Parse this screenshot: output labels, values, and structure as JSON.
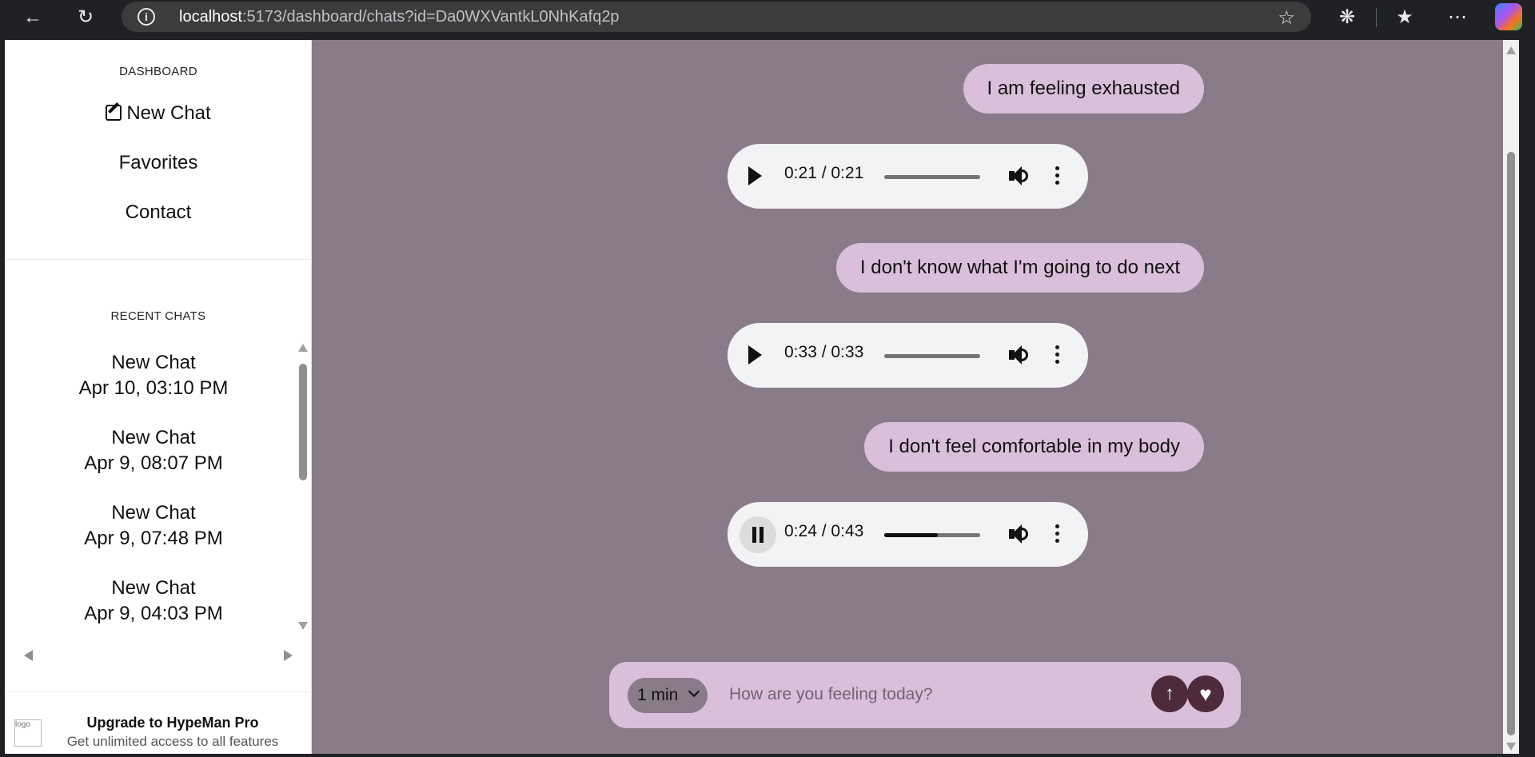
{
  "browser": {
    "url_host": "localhost",
    "url_rest": ":5173/dashboard/chats?id=Da0WXVantkL0NhKafq2p",
    "icons": [
      "back-icon",
      "reload-icon",
      "info-icon",
      "favorite-star-icon",
      "extensions-icon",
      "favorites-icon",
      "more-icon",
      "copilot-icon"
    ]
  },
  "sidebar": {
    "heading": "DASHBOARD",
    "new_chat_label": "New Chat",
    "favorites_label": "Favorites",
    "contact_label": "Contact",
    "recent_heading": "RECENT CHATS",
    "recent_chats": [
      {
        "title": "New Chat",
        "date": "Apr 10, 03:10 PM"
      },
      {
        "title": "New Chat",
        "date": "Apr 9, 08:07 PM"
      },
      {
        "title": "New Chat",
        "date": "Apr 9, 07:48 PM"
      },
      {
        "title": "New Chat",
        "date": "Apr 9, 04:03 PM"
      }
    ],
    "upgrade": {
      "logo_alt": "logo",
      "title": "Upgrade to HypeMan Pro",
      "subtitle": "Get unlimited access to all features"
    }
  },
  "chat": {
    "messages": [
      {
        "text": "I am feeling exhausted"
      },
      {
        "audio_time": "0:21 / 0:21",
        "progress": 0,
        "state": "paused"
      },
      {
        "text": "I don't know what I'm going to do next"
      },
      {
        "audio_time": "0:33 / 0:33",
        "progress": 0,
        "state": "paused"
      },
      {
        "text": "I don't feel comfortable in my body"
      },
      {
        "audio_time": "0:24 / 0:43",
        "progress": 0.56,
        "state": "playing"
      }
    ]
  },
  "composer": {
    "duration_value": "1 min",
    "placeholder": "How are you feeling today?"
  },
  "colors": {
    "background": "#8a7b8a",
    "bubble": "#d9bfd9",
    "button": "#4e2a3b"
  }
}
